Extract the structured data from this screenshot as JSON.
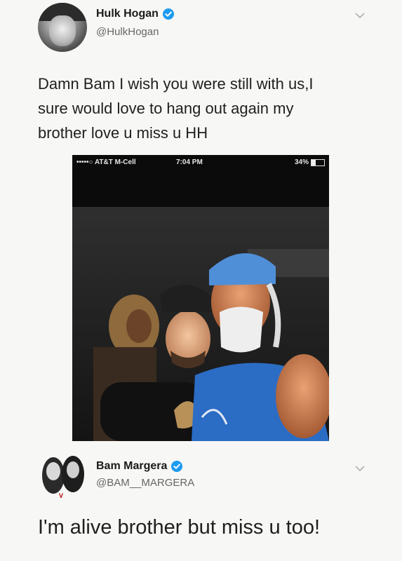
{
  "tweet1": {
    "display_name": "Hulk Hogan",
    "handle": "@HulkHogan",
    "text": "Damn Bam I wish you were still with us,I\nsure would love to hang out again my\nbrother love u miss u HH",
    "attachment": {
      "status_bar": {
        "carrier": "•••••○ AT&T M-Cell",
        "time": "7:04 PM",
        "battery": "34%"
      }
    }
  },
  "tweet2": {
    "display_name": "Bam Margera",
    "handle": "@BAM__MARGERA",
    "text": "I'm alive brother but miss u too!"
  },
  "colors": {
    "verified": "#1d9bf0",
    "background": "#f7f7f5"
  },
  "icons": {
    "verified": "verified-badge-icon",
    "more": "chevron-down-icon",
    "wifi": "wifi-icon",
    "battery": "battery-icon"
  }
}
